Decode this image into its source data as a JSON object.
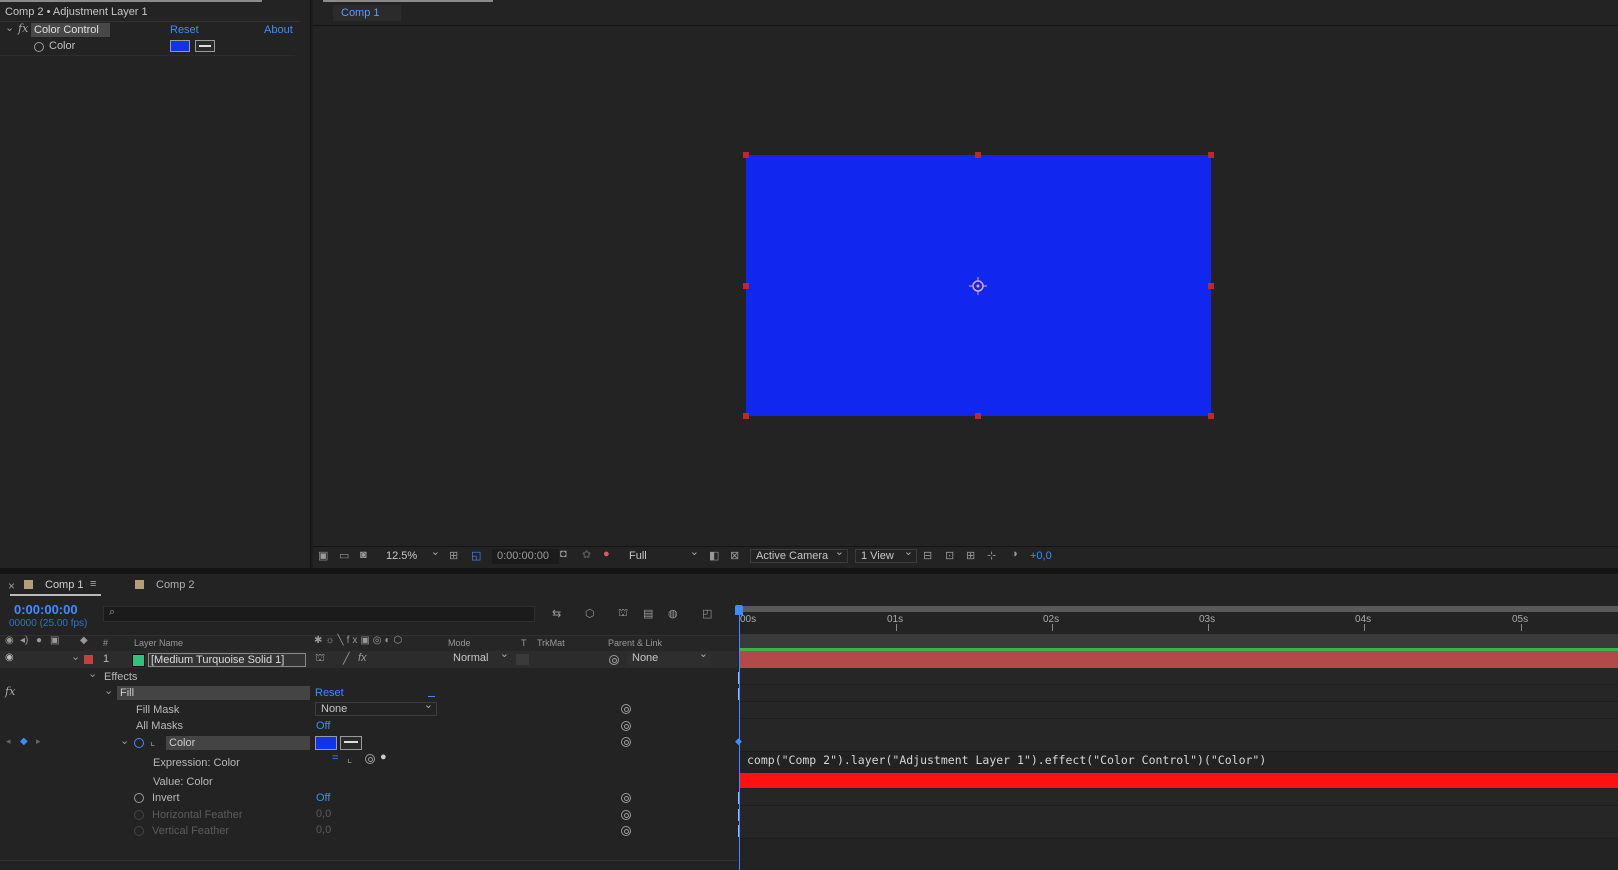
{
  "effect_controls": {
    "title": "Comp 2 • Adjustment Layer 1",
    "effect_name": "Color Control",
    "fx_label": "fx",
    "reset_label": "Reset",
    "about_label": "About",
    "property_label": "Color",
    "color_value": "#1133ee"
  },
  "viewer": {
    "tab_label": "Comp 1",
    "solid_color": "#1126ee",
    "zoom": "12.5%",
    "timecode": "0:00:00:00",
    "resolution": "Full",
    "camera": "Active Camera",
    "views": "1 View",
    "exposure": "+0,0"
  },
  "timeline": {
    "tabs": [
      {
        "label": "Comp 1",
        "active": true
      },
      {
        "label": "Comp 2",
        "active": false
      }
    ],
    "close_label": "×",
    "current_time": "0:00:00:00",
    "frame_info": "00000 (25.00 fps)",
    "column_headers": {
      "number": "#",
      "layer_name": "Layer Name",
      "mode": "Mode",
      "t": "T",
      "trkmat": "TrkMat",
      "parent": "Parent & Link"
    },
    "layer": {
      "index": "1",
      "name": "[Medium Turquoise Solid 1]",
      "mode": "Normal",
      "parent": "None",
      "label_color": "#2ec27e"
    },
    "effects_group": "Effects",
    "fill_effect": "Fill",
    "reset_label": "Reset",
    "properties": [
      {
        "name": "Fill Mask",
        "value": "None"
      },
      {
        "name": "All Masks",
        "value": "Off"
      },
      {
        "name": "Color",
        "value": ""
      },
      {
        "name": "Expression: Color",
        "value": ""
      },
      {
        "name": "Value: Color",
        "value": ""
      },
      {
        "name": "Invert",
        "value": "Off"
      },
      {
        "name": "Horizontal Feather",
        "value": "0,0"
      },
      {
        "name": "Vertical Feather",
        "value": "0,0"
      }
    ],
    "ruler_labels": [
      "00s",
      "01s",
      "02s",
      "03s",
      "04s",
      "05s"
    ],
    "expression_text": "comp(\"Comp 2\").layer(\"Adjustment Layer 1\").effect(\"Color Control\")(\"Color\")"
  }
}
